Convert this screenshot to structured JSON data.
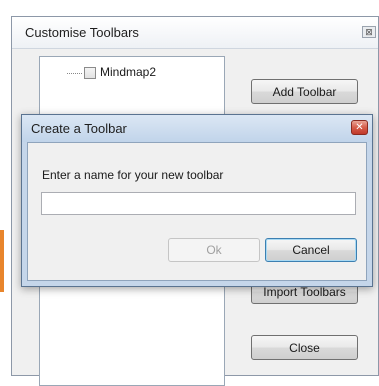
{
  "outer_dialog": {
    "title": "Customise Toolbars",
    "close_glyph": "⊠",
    "tree": {
      "items": [
        {
          "label": "Mindmap2",
          "checked": false
        }
      ]
    },
    "buttons": {
      "add_toolbar": "Add Toolbar",
      "import_toolbars": "Import Toolbars",
      "close": "Close"
    }
  },
  "inner_dialog": {
    "title": "Create a Toolbar",
    "close_glyph": "✕",
    "prompt": "Enter a name for your new toolbar",
    "input": {
      "value": "",
      "placeholder": ""
    },
    "buttons": {
      "ok": "Ok",
      "cancel": "Cancel"
    }
  },
  "colors": {
    "accent": "#e8852c",
    "title_bar_inner": "#c5d6ea",
    "close_red": "#c0392b",
    "focus_border": "#3c7fb1"
  }
}
